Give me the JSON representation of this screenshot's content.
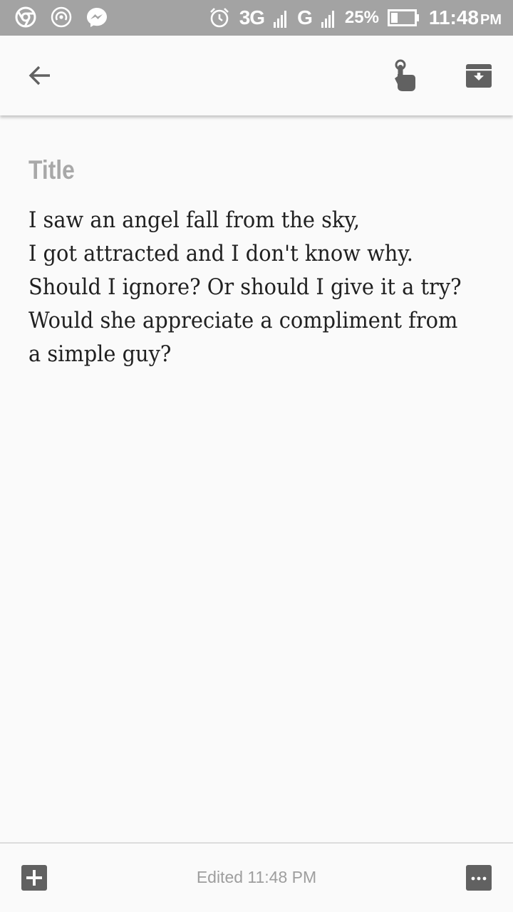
{
  "status_bar": {
    "network": "3G",
    "network2": "G",
    "battery": "25%",
    "time": "11:48",
    "ampm": "PM",
    "icons": [
      "chrome-icon",
      "hotspot-icon",
      "messenger-icon",
      "alarm-icon",
      "signal-icon",
      "battery-icon"
    ]
  },
  "toolbar": {
    "icons": [
      "back-arrow-icon",
      "pin-finger-icon",
      "archive-icon"
    ]
  },
  "note": {
    "title_placeholder": "Title",
    "body_lines": [
      "I saw an angel fall from the sky,",
      "I got attracted and I don't know why.",
      "Should I ignore? Or should I give it a try?",
      "Would she appreciate a compliment from",
      "a simple guy?"
    ]
  },
  "bottom_bar": {
    "edited_label": "Edited 11:48 PM",
    "icons": [
      "add-box-icon",
      "more-options-icon"
    ]
  },
  "colors": {
    "status_bar_bg": "#a3a3a3",
    "background": "#fafafa",
    "icon_gray": "#666666",
    "title_placeholder": "#a8a8a8",
    "body_text": "#202020"
  }
}
